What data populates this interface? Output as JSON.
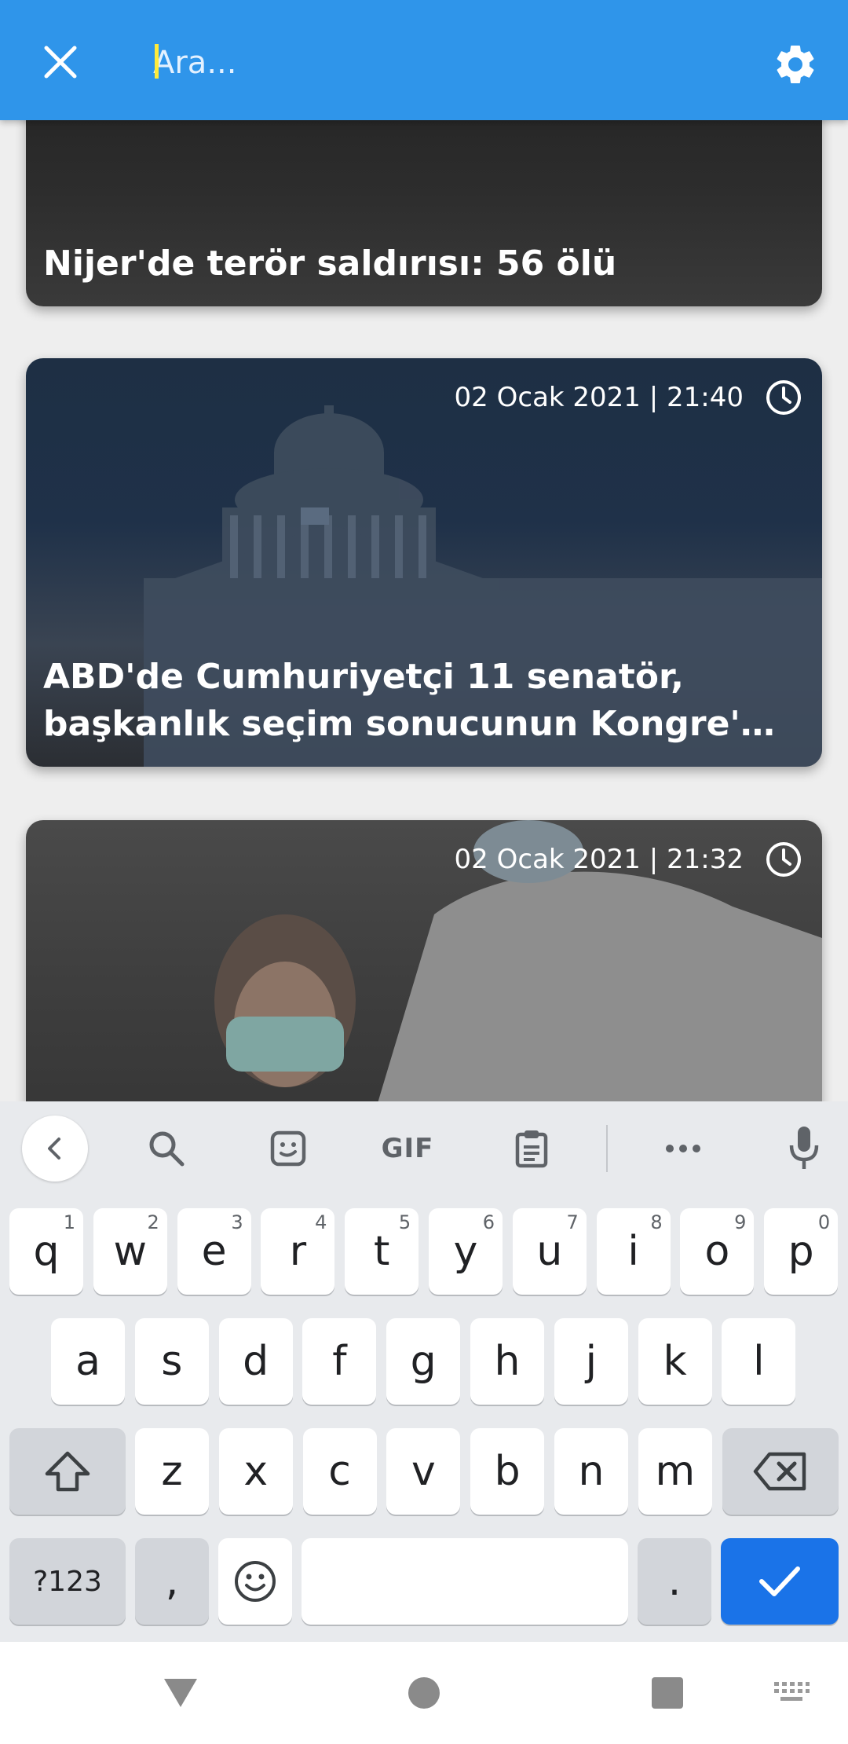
{
  "search": {
    "placeholder": "Ara..."
  },
  "icons": {
    "close": "close-icon",
    "settings": "gear-icon",
    "clock": "clock-icon"
  },
  "colors": {
    "app_bar": "#2f95ea",
    "enter_key": "#1a73e8",
    "keyboard_bg": "#e8eaed"
  },
  "news": [
    {
      "title": "Nijer'de terör saldırısı: 56 ölü",
      "time": ""
    },
    {
      "title_line1": "ABD'de Cumhuriyetçi 11 senatör,",
      "title_line2": "başkanlık seçim sonucunun Kongre'de ...",
      "time": "02 Ocak 2021 | 21:40"
    },
    {
      "title": "",
      "time": "02 Ocak 2021 | 21:32"
    }
  ],
  "keyboard": {
    "toolbar": {
      "gif": "GIF"
    },
    "row1": [
      {
        "key": "q",
        "hint": "1"
      },
      {
        "key": "w",
        "hint": "2"
      },
      {
        "key": "e",
        "hint": "3"
      },
      {
        "key": "r",
        "hint": "4"
      },
      {
        "key": "t",
        "hint": "5"
      },
      {
        "key": "y",
        "hint": "6"
      },
      {
        "key": "u",
        "hint": "7"
      },
      {
        "key": "i",
        "hint": "8"
      },
      {
        "key": "o",
        "hint": "9"
      },
      {
        "key": "p",
        "hint": "0"
      }
    ],
    "row2": [
      "a",
      "s",
      "d",
      "f",
      "g",
      "h",
      "j",
      "k",
      "l"
    ],
    "row3": [
      "z",
      "x",
      "c",
      "v",
      "b",
      "n",
      "m"
    ],
    "symbols_label": "?123",
    "comma": ",",
    "period": "."
  }
}
